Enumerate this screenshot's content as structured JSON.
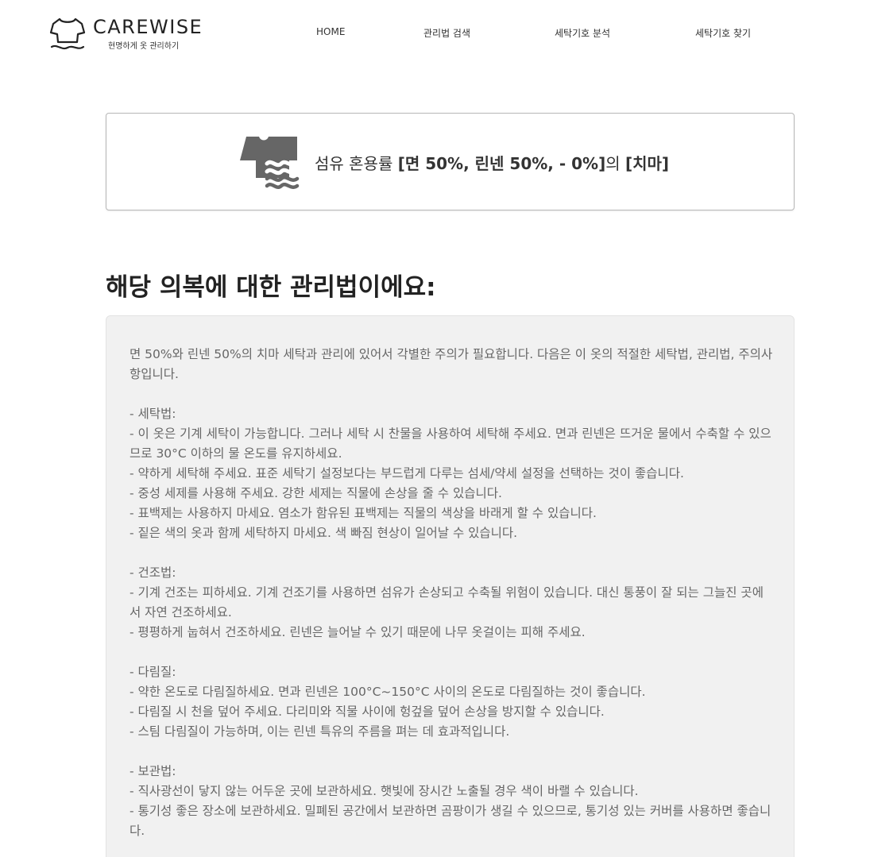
{
  "header": {
    "logo": {
      "title": "CAREWISE",
      "subtitle": "현명하게 옷 관리하기"
    },
    "nav": [
      {
        "label": "HOME"
      },
      {
        "label": "관리법 검색"
      },
      {
        "label": "세탁기호 분석"
      },
      {
        "label": "세탁기호 찾기"
      }
    ]
  },
  "garment": {
    "icon": "shirt-wash-icon",
    "prefix": "섬유 혼용률 ",
    "fabric": "[면 50%, 린넨 50%, - 0%]",
    "connector": "의 ",
    "type": "[치마]"
  },
  "section_title": "해당 의복에 대한 관리법이에요:",
  "care_text": "면 50%와 린넨 50%의 치마 세탁과 관리에 있어서 각별한 주의가 필요합니다. 다음은 이 옷의 적절한 세탁법, 관리법, 주의사항입니다.\n\n- 세탁법:\n- 이 옷은 기계 세탁이 가능합니다. 그러나 세탁 시 찬물을 사용하여 세탁해 주세요. 면과 린넨은 뜨거운 물에서 수축할 수 있으므로 30°C 이하의 물 온도를 유지하세요.\n- 약하게 세탁해 주세요. 표준 세탁기 설정보다는 부드럽게 다루는 섬세/약세 설정을 선택하는 것이 좋습니다.\n- 중성 세제를 사용해 주세요. 강한 세제는 직물에 손상을 줄 수 있습니다.\n- 표백제는 사용하지 마세요. 염소가 함유된 표백제는 직물의 색상을 바래게 할 수 있습니다.\n- 짙은 색의 옷과 함께 세탁하지 마세요. 색 빠짐 현상이 일어날 수 있습니다.\n\n- 건조법:\n- 기계 건조는 피하세요. 기계 건조기를 사용하면 섬유가 손상되고 수축될 위험이 있습니다. 대신 통풍이 잘 되는 그늘진 곳에서 자연 건조하세요.\n- 평평하게 눕혀서 건조하세요. 린넨은 늘어날 수 있기 때문에 나무 옷걸이는 피해 주세요.\n\n- 다림질:\n- 약한 온도로 다림질하세요. 면과 린넨은 100°C~150°C 사이의 온도로 다림질하는 것이 좋습니다.\n- 다림질 시 천을 덮어 주세요. 다리미와 직물 사이에 헝겊을 덮어 손상을 방지할 수 있습니다.\n- 스팀 다림질이 가능하며, 이는 린넨 특유의 주름을 펴는 데 효과적입니다.\n\n- 보관법:\n- 직사광선이 닿지 않는 어두운 곳에 보관하세요. 햇빛에 장시간 노출될 경우 색이 바랠 수 있습니다.\n- 통기성 좋은 장소에 보관하세요. 밀폐된 공간에서 보관하면 곰팡이가 생길 수 있으므로, 통기성 있는 커버를 사용하면 좋습니다.",
  "colors": {
    "icon": "#666666",
    "text": "#333333",
    "care_text": "#666666",
    "content_bg": "#f1f1f1",
    "border": "#b7b7b7"
  }
}
